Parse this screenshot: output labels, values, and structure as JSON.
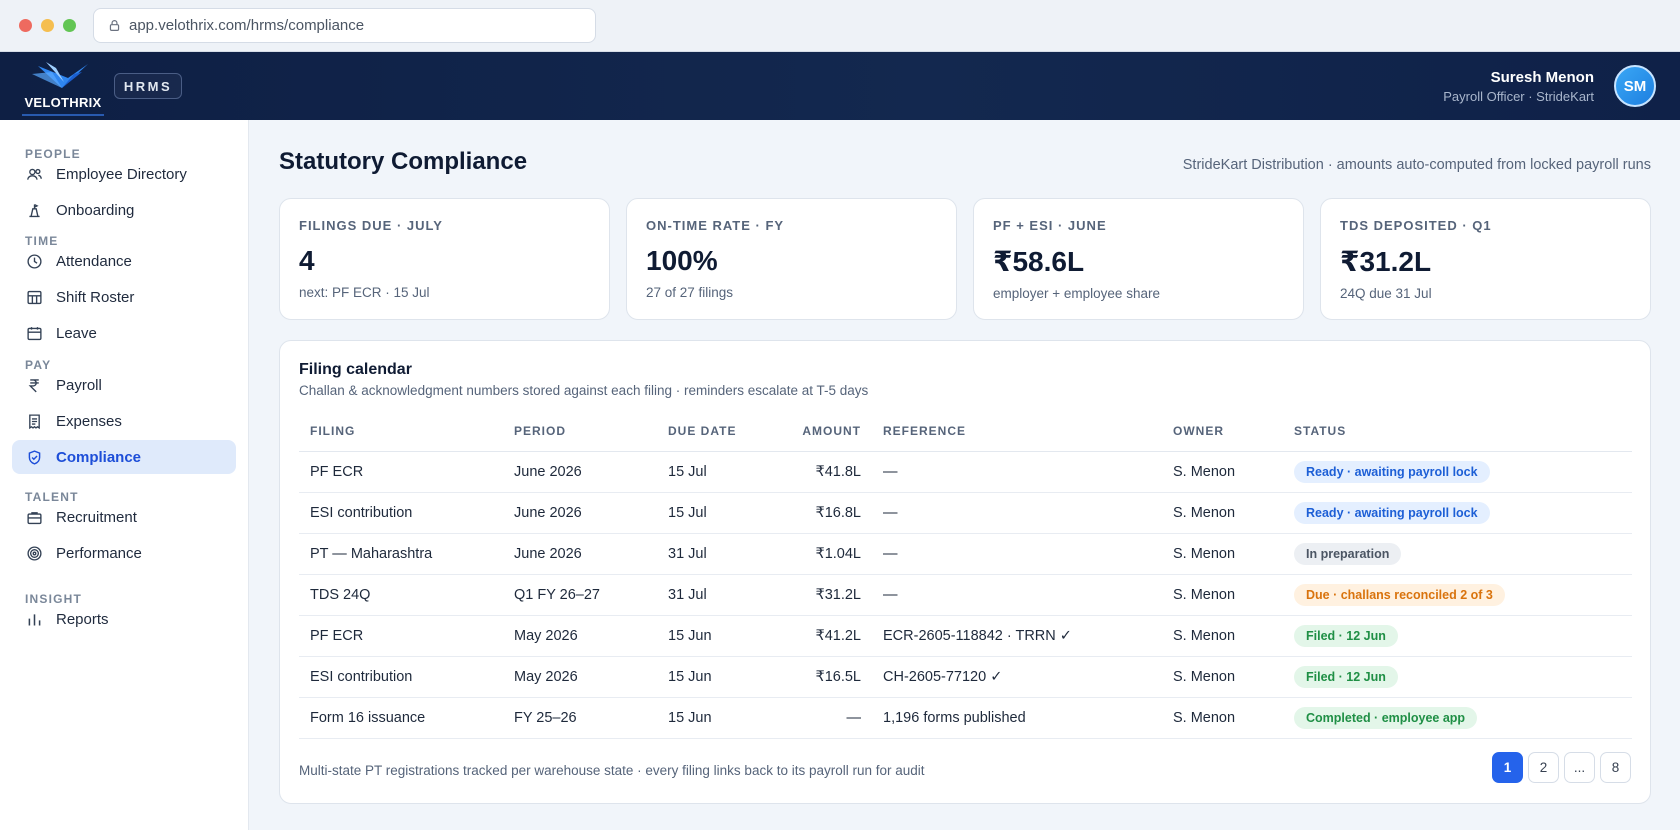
{
  "browser": {
    "url": "app.velothrix.com/hrms/compliance"
  },
  "header": {
    "logo_text": "VELOTHRIX",
    "module_chip": "HRMS",
    "user_name": "Suresh Menon",
    "user_role": "Payroll Officer · StrideKart",
    "avatar_initials": "SM"
  },
  "sidebar": {
    "groups": [
      {
        "label": "PEOPLE",
        "items": [
          {
            "label": "Employee Directory",
            "icon": "users-icon"
          },
          {
            "label": "Onboarding",
            "icon": "onboarding-icon"
          }
        ]
      },
      {
        "label": "TIME",
        "items": [
          {
            "label": "Attendance",
            "icon": "clock-icon"
          },
          {
            "label": "Shift Roster",
            "icon": "grid-icon"
          },
          {
            "label": "Leave",
            "icon": "calendar-icon"
          }
        ]
      },
      {
        "label": "PAY",
        "items": [
          {
            "label": "Payroll",
            "icon": "rupee-icon"
          },
          {
            "label": "Expenses",
            "icon": "receipt-icon"
          },
          {
            "label": "Compliance",
            "icon": "shield-check-icon",
            "active": true
          }
        ]
      },
      {
        "label": "TALENT",
        "items": [
          {
            "label": "Recruitment",
            "icon": "briefcase-icon"
          },
          {
            "label": "Performance",
            "icon": "target-icon"
          }
        ]
      },
      {
        "label": "INSIGHT",
        "items": [
          {
            "label": "Reports",
            "icon": "bar-chart-icon"
          }
        ]
      }
    ]
  },
  "page": {
    "title": "Statutory Compliance",
    "subtitle": "StrideKart Distribution · amounts auto-computed from locked payroll runs"
  },
  "kpis": [
    {
      "label": "FILINGS DUE · JULY",
      "value": "4",
      "foot": "next: PF ECR · 15 Jul"
    },
    {
      "label": "ON-TIME RATE · FY",
      "value": "100%",
      "foot": "27 of 27 filings"
    },
    {
      "label": "PF + ESI · JUNE",
      "value": "₹58.6L",
      "foot": "employer + employee share"
    },
    {
      "label": "TDS DEPOSITED · Q1",
      "value": "₹31.2L",
      "foot": "24Q due 31 Jul"
    }
  ],
  "calendar": {
    "title": "Filing calendar",
    "subtitle": "Challan & acknowledgment numbers stored against each filing · reminders escalate at T-5 days",
    "columns": [
      "FILING",
      "PERIOD",
      "DUE DATE",
      "AMOUNT",
      "REFERENCE",
      "OWNER",
      "STATUS"
    ],
    "rows": [
      {
        "filing": "PF ECR",
        "period": "June 2026",
        "due": "15 Jul",
        "amount": "₹41.8L",
        "reference": "—",
        "owner": "S. Menon",
        "status": "Ready · awaiting payroll lock",
        "tone": "blue"
      },
      {
        "filing": "ESI contribution",
        "period": "June 2026",
        "due": "15 Jul",
        "amount": "₹16.8L",
        "reference": "—",
        "owner": "S. Menon",
        "status": "Ready · awaiting payroll lock",
        "tone": "blue"
      },
      {
        "filing": "PT — Maharashtra",
        "period": "June 2026",
        "due": "31 Jul",
        "amount": "₹1.04L",
        "reference": "—",
        "owner": "S. Menon",
        "status": "In preparation",
        "tone": "gray"
      },
      {
        "filing": "TDS 24Q",
        "period": "Q1 FY 26–27",
        "due": "31 Jul",
        "amount": "₹31.2L",
        "reference": "—",
        "owner": "S. Menon",
        "status": "Due · challans reconciled 2 of 3",
        "tone": "orange"
      },
      {
        "filing": "PF ECR",
        "period": "May 2026",
        "due": "15 Jun",
        "amount": "₹41.2L",
        "reference": "ECR-2605-118842 · TRRN ✓",
        "owner": "S. Menon",
        "status": "Filed · 12 Jun",
        "tone": "green"
      },
      {
        "filing": "ESI contribution",
        "period": "May 2026",
        "due": "15 Jun",
        "amount": "₹16.5L",
        "reference": "CH-2605-77120 ✓",
        "owner": "S. Menon",
        "status": "Filed · 12 Jun",
        "tone": "green"
      },
      {
        "filing": "Form 16 issuance",
        "period": "FY 25–26",
        "due": "15 Jun",
        "amount": "—",
        "reference": "1,196 forms published",
        "owner": "S. Menon",
        "status": "Completed · employee app",
        "tone": "green"
      }
    ],
    "footnote": "Multi-state PT registrations tracked per warehouse state · every filing links back to its payroll run for audit",
    "pages": [
      "1",
      "2",
      "...",
      "8"
    ],
    "current_page": "1"
  },
  "colors": {
    "accent": "#2563eb",
    "header_bg": "#0e1f44",
    "active_nav_bg": "#dfeafb"
  }
}
